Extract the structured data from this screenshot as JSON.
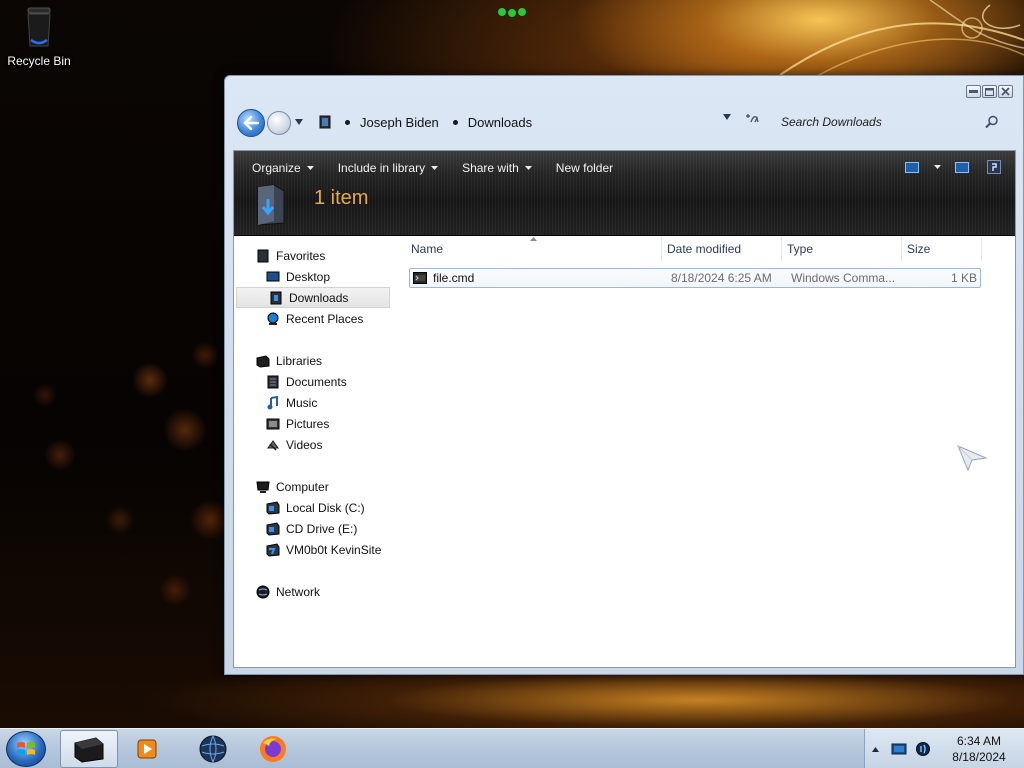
{
  "desktop": {
    "icons": [
      {
        "label": "Recycle Bin",
        "icon": "recycle-bin-icon"
      }
    ]
  },
  "window": {
    "controls": [
      "minimize",
      "maximize",
      "close"
    ],
    "address": {
      "breadcrumbs": [
        "Joseph Biden",
        "Downloads"
      ]
    },
    "search": {
      "placeholder": "Search Downloads"
    },
    "toolbar": {
      "organize": "Organize",
      "include_in_library": "Include in library",
      "share_with": "Share with",
      "new_folder": "New folder"
    },
    "item_count": "1 item",
    "nav": {
      "favorites": {
        "label": "Favorites",
        "items": [
          "Desktop",
          "Downloads",
          "Recent Places"
        ]
      },
      "libraries": {
        "label": "Libraries",
        "items": [
          "Documents",
          "Music",
          "Pictures",
          "Videos"
        ]
      },
      "computer": {
        "label": "Computer",
        "items": [
          "Local Disk (C:)",
          "CD Drive (E:)",
          "VM0b0t KevinSite"
        ]
      },
      "network": {
        "label": "Network"
      },
      "selected": "Downloads"
    },
    "columns": {
      "name": "Name",
      "date_modified": "Date modified",
      "type": "Type",
      "size": "Size"
    },
    "files": [
      {
        "name": "file.cmd",
        "date_modified": "8/18/2024 6:25 AM",
        "type": "Windows Comma...",
        "size": "1 KB"
      }
    ]
  },
  "taskbar": {
    "apps": [
      "explorer-icon",
      "media-player-icon",
      "globe-icon",
      "firefox-icon"
    ],
    "clock": {
      "time": "6:34 AM",
      "date": "8/18/2024"
    }
  },
  "colors": {
    "accent_orange": "#e6a94a",
    "toolbar_dark": "#1a1a1a",
    "taskbar_blue": "#b5c7dc"
  }
}
